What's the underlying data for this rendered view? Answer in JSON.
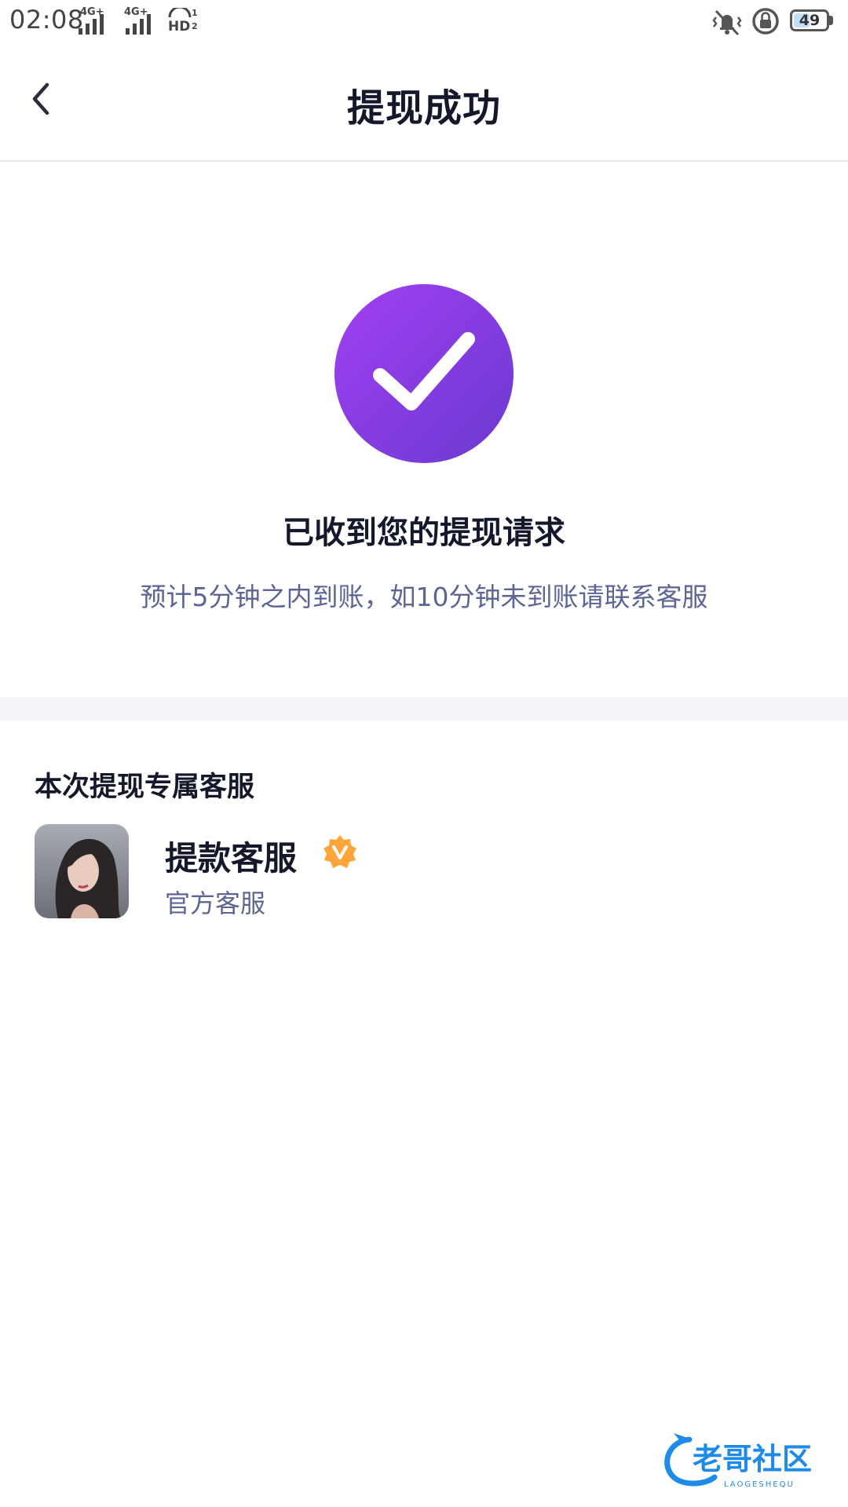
{
  "status_bar": {
    "time": "02:08",
    "network1": "4G+",
    "network2": "4G+",
    "hd": "HD",
    "hd_sim": "1 2",
    "battery_level": "49",
    "battery_fraction": 0.49,
    "icons": [
      "vibrate-icon",
      "rotation-lock-icon",
      "battery-icon"
    ]
  },
  "header": {
    "title": "提现成功",
    "back_icon": "chevron-left-icon"
  },
  "result": {
    "icon": "check-circle-icon",
    "accent_colors": [
      "#a23ff2",
      "#6a3ad0"
    ],
    "headline": "已收到您的提现请求",
    "description": "预计5分钟之内到账，如10分钟未到账请联系客服"
  },
  "service": {
    "section_title": "本次提现专属客服",
    "name": "提款客服",
    "role": "官方客服",
    "badge_icon": "verified-badge-icon",
    "badge_color": "#ffa53a"
  },
  "watermark": {
    "text": "老哥社区",
    "subtext": "LAOGESHEQU",
    "color": "#1f8be8"
  }
}
